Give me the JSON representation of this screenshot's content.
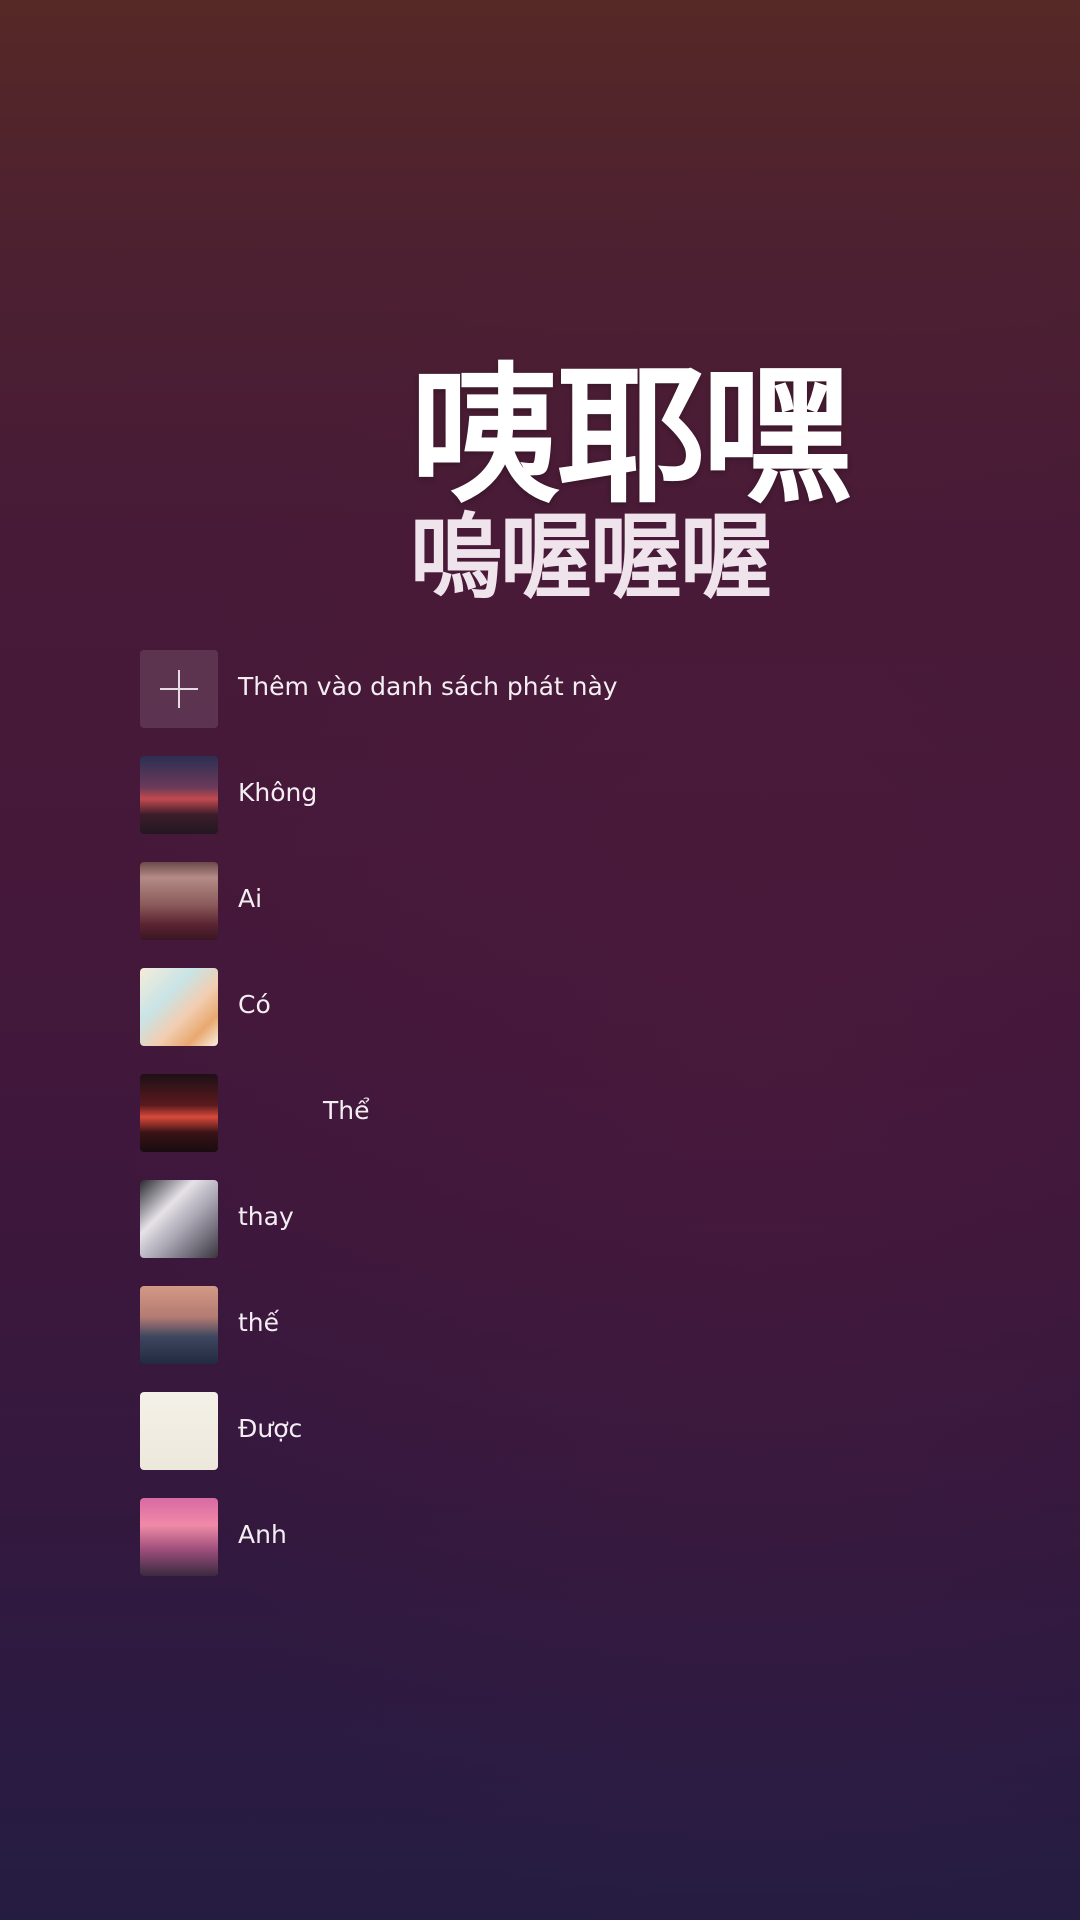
{
  "lyrics": {
    "line1": "咦耶嘿",
    "line2": "嗚喔喔喔"
  },
  "playlist": {
    "add_label": "Thêm vào danh sách phát này",
    "add_icon": "plus-icon",
    "items": [
      {
        "label": "Không",
        "art": "album-art"
      },
      {
        "label": "Ai",
        "art": "album-art"
      },
      {
        "label": "Có",
        "art": "album-art"
      },
      {
        "label": "Thể",
        "art": "album-art"
      },
      {
        "label": "thay",
        "art": "album-art"
      },
      {
        "label": "thế",
        "art": "album-art"
      },
      {
        "label": "Được",
        "art": "album-art"
      },
      {
        "label": "Anh",
        "art": "album-art"
      }
    ]
  }
}
